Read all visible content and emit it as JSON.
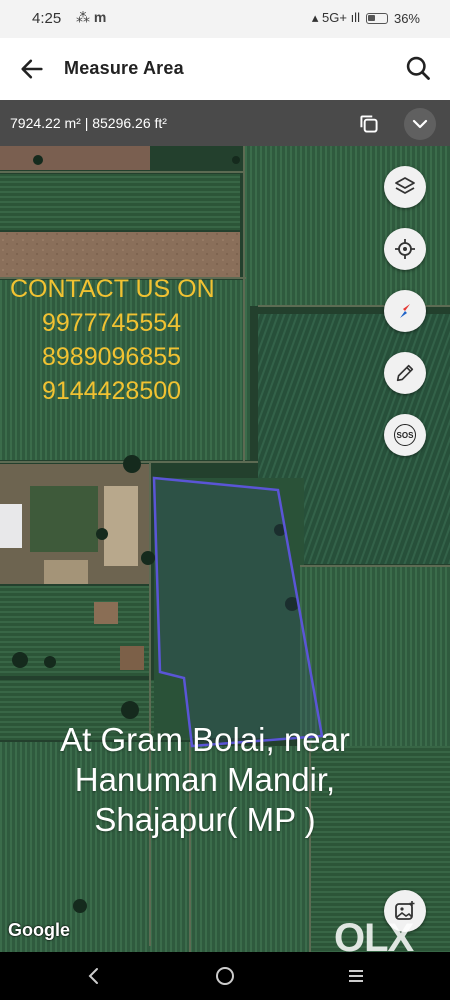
{
  "status_bar": {
    "time": "4:25",
    "left_icons": "📶 m",
    "network": "Vo̅ 5G+",
    "battery": "36%"
  },
  "header": {
    "title": "Measure Area",
    "back_icon": "arrow-left-icon",
    "search_icon": "search-icon"
  },
  "measure": {
    "area_text": "7924.22 m²  |  85296.26 ft²"
  },
  "map": {
    "contact_heading": "CONTACT US ON",
    "phones": [
      "9977745554",
      "8989096855",
      "9144428500"
    ],
    "location_lines": [
      "At Gram Bolai, near",
      "Hanuman Mandir,",
      "Shajapur( MP )"
    ],
    "attribution": "Google",
    "watermark": "OLX",
    "buttons": [
      "layers-icon",
      "my-location-icon",
      "compass-icon",
      "pencil-icon",
      "sos-icon",
      "gallery-icon"
    ],
    "sos_label": "SOS"
  },
  "colors": {
    "contact_text": "#f1c232",
    "polygon_outline": "#5a55d6",
    "measure_bar": "#4a4a4a"
  }
}
